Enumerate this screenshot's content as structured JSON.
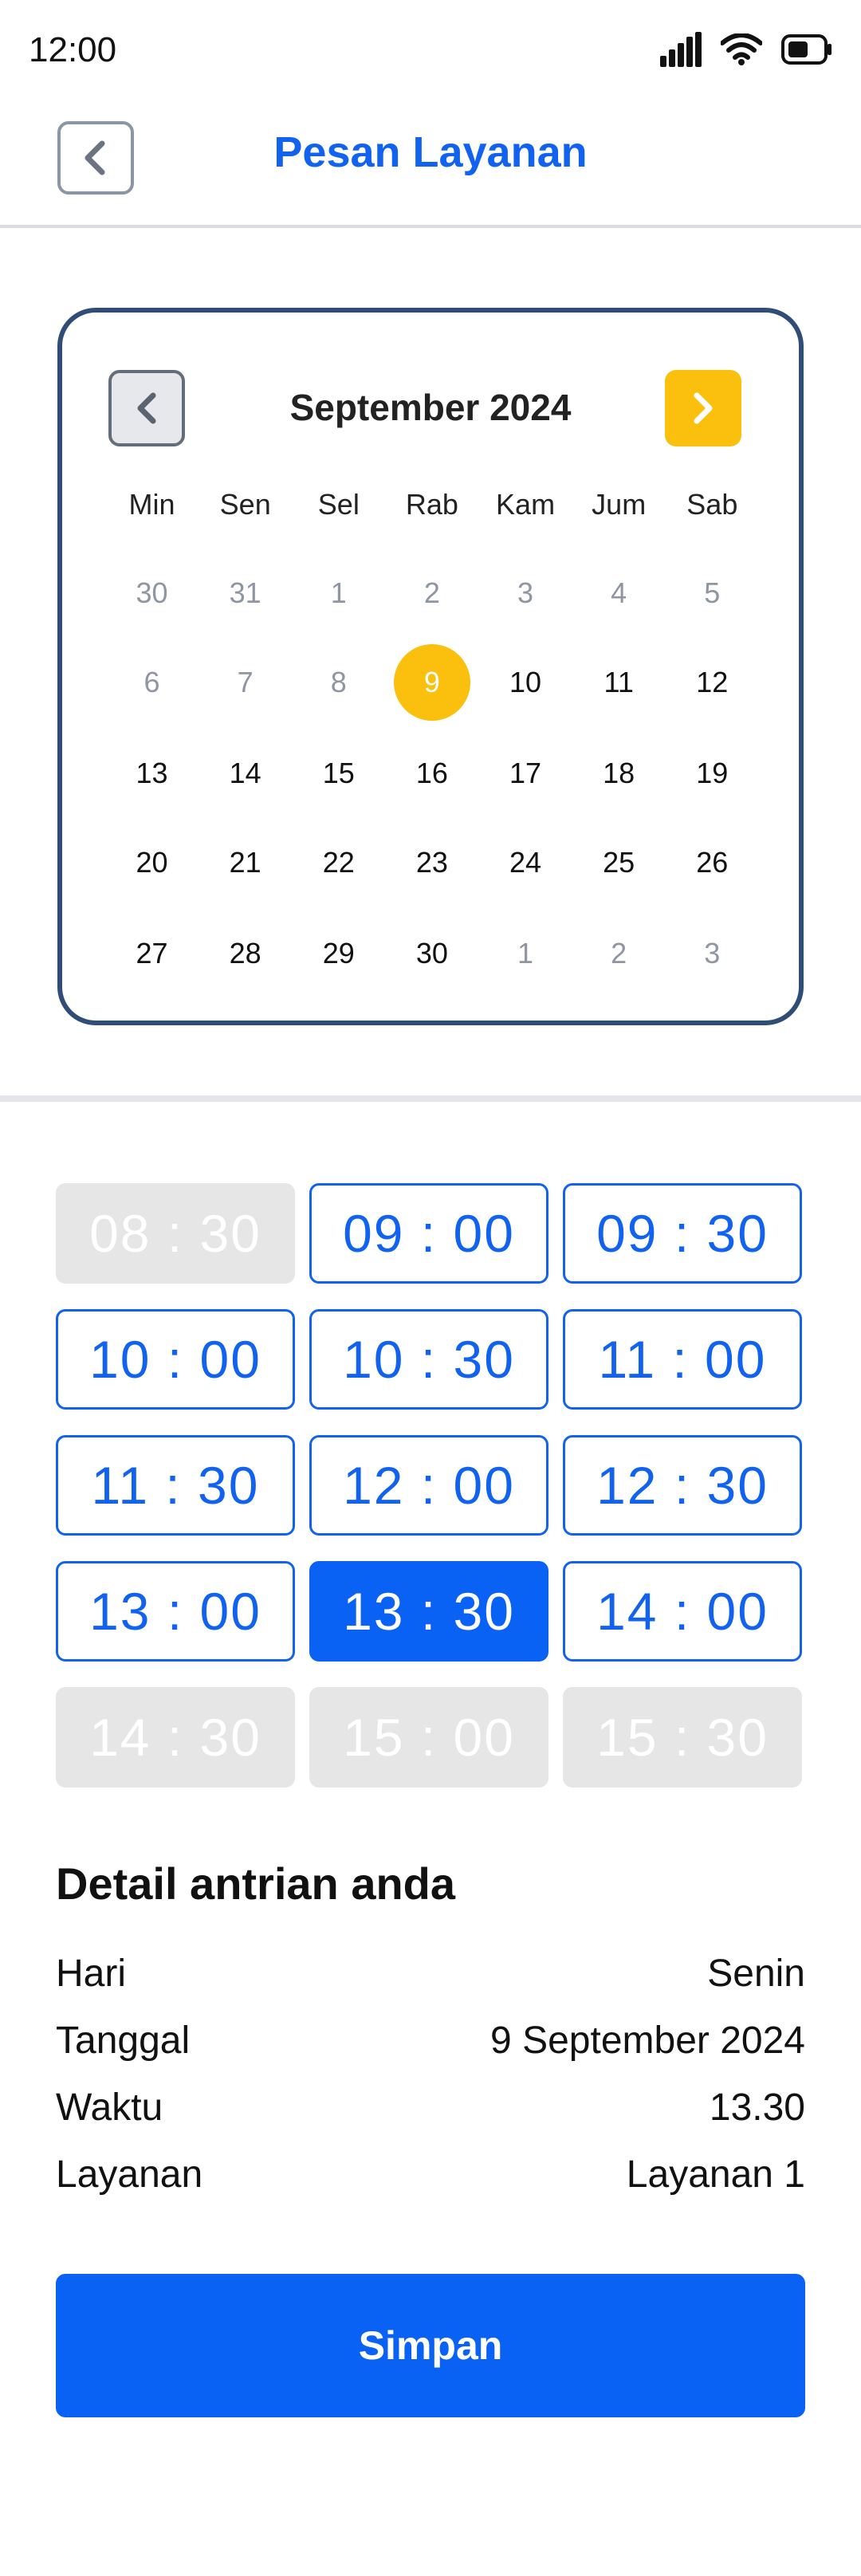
{
  "status_bar": {
    "time": "12:00"
  },
  "header": {
    "title": "Pesan Layanan"
  },
  "calendar": {
    "month_label": "September 2024",
    "weekdays": [
      "Min",
      "Sen",
      "Sel",
      "Rab",
      "Kam",
      "Jum",
      "Sab"
    ],
    "weeks": [
      [
        {
          "d": "30",
          "muted": true
        },
        {
          "d": "31",
          "muted": true
        },
        {
          "d": "1",
          "muted": true
        },
        {
          "d": "2",
          "muted": true
        },
        {
          "d": "3",
          "muted": true
        },
        {
          "d": "4",
          "muted": true
        },
        {
          "d": "5",
          "muted": true
        }
      ],
      [
        {
          "d": "6",
          "muted": true
        },
        {
          "d": "7",
          "muted": true
        },
        {
          "d": "8",
          "muted": true
        },
        {
          "d": "9",
          "selected": true
        },
        {
          "d": "10"
        },
        {
          "d": "11"
        },
        {
          "d": "12"
        }
      ],
      [
        {
          "d": "13"
        },
        {
          "d": "14"
        },
        {
          "d": "15"
        },
        {
          "d": "16"
        },
        {
          "d": "17"
        },
        {
          "d": "18"
        },
        {
          "d": "19"
        }
      ],
      [
        {
          "d": "20"
        },
        {
          "d": "21"
        },
        {
          "d": "22"
        },
        {
          "d": "23"
        },
        {
          "d": "24"
        },
        {
          "d": "25"
        },
        {
          "d": "26"
        }
      ],
      [
        {
          "d": "27"
        },
        {
          "d": "28"
        },
        {
          "d": "29"
        },
        {
          "d": "30"
        },
        {
          "d": "1",
          "muted": true
        },
        {
          "d": "2",
          "muted": true
        },
        {
          "d": "3",
          "muted": true
        }
      ]
    ]
  },
  "time_slots": [
    {
      "label": "08 : 30",
      "state": "disabled"
    },
    {
      "label": "09 : 00",
      "state": "available"
    },
    {
      "label": "09 : 30",
      "state": "available"
    },
    {
      "label": "10 : 00",
      "state": "available"
    },
    {
      "label": "10 : 30",
      "state": "available"
    },
    {
      "label": "11 : 00",
      "state": "available"
    },
    {
      "label": "11 : 30",
      "state": "available"
    },
    {
      "label": "12 : 00",
      "state": "available"
    },
    {
      "label": "12 : 30",
      "state": "available"
    },
    {
      "label": "13 : 00",
      "state": "available"
    },
    {
      "label": "13 : 30",
      "state": "active"
    },
    {
      "label": "14 : 00",
      "state": "available"
    },
    {
      "label": "14 : 30",
      "state": "disabled"
    },
    {
      "label": "15 : 00",
      "state": "disabled"
    },
    {
      "label": "15 : 30",
      "state": "disabled"
    }
  ],
  "detail": {
    "title": "Detail antrian anda",
    "rows": [
      {
        "label": "Hari",
        "value": "Senin"
      },
      {
        "label": "Tanggal",
        "value": "9 September 2024"
      },
      {
        "label": "Waktu",
        "value": "13.30"
      },
      {
        "label": "Layanan",
        "value": "Layanan 1"
      }
    ]
  },
  "save_button": {
    "label": "Simpan"
  },
  "colors": {
    "primary": "#0a62f5",
    "accent_yellow": "#fbbf0e",
    "card_border": "#2f4d75",
    "muted_text": "#8f96a1"
  }
}
